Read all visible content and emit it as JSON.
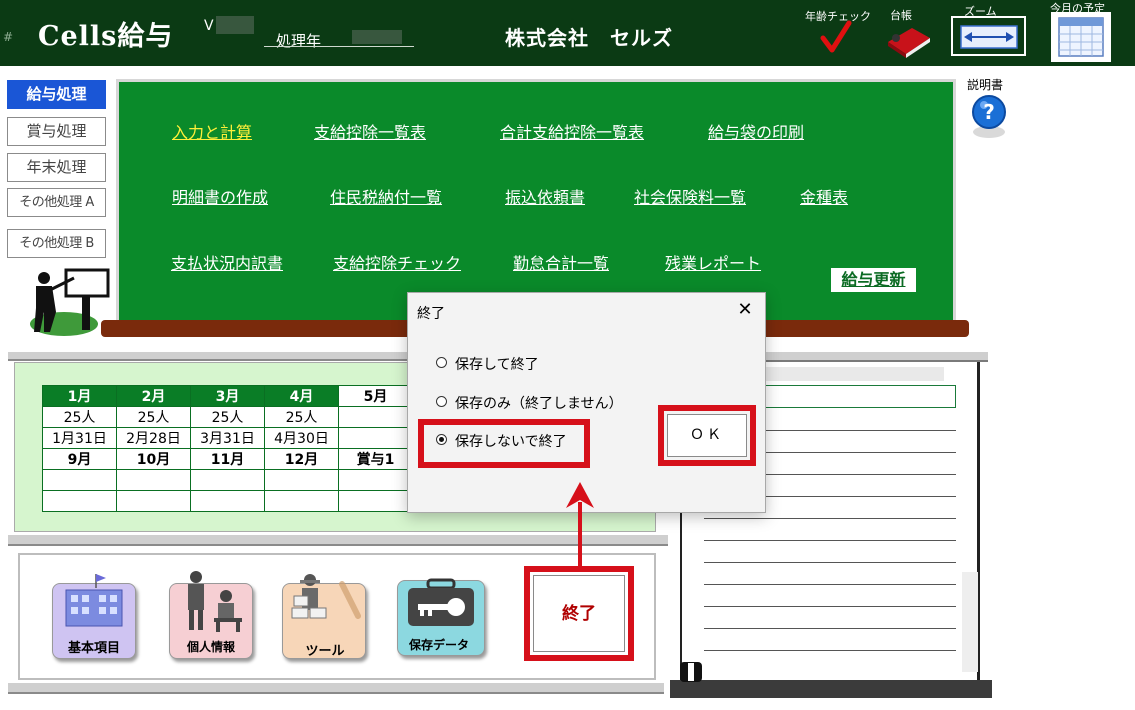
{
  "header": {
    "hash": "#",
    "app_title": "Cells給与",
    "version_prefix": "V",
    "year_label": "処理年",
    "company": "株式会社　セルズ",
    "age_check_label": "年齢チェック",
    "ledger_label": "台帳",
    "zoom_label": "ズーム",
    "schedule_label": "今月の予定"
  },
  "nav": {
    "items": [
      "給与処理",
      "賞与処理",
      "年末処理",
      "その他処理 A",
      "その他処理 B"
    ],
    "active_index": 0
  },
  "board": {
    "menu_row1": [
      "入力と計算",
      "支給控除一覧表",
      "合計支給控除一覧表",
      "給与袋の印刷"
    ],
    "menu_row2": [
      "明細書の作成",
      "住民税納付一覧",
      "振込依頼書",
      "社会保険料一覧",
      "金種表"
    ],
    "menu_row3": [
      "支払状況内訳書",
      "支給控除チェック",
      "勤怠合計一覧",
      "残業レポート"
    ],
    "update_button": "給与更新",
    "manual_label": "説明書"
  },
  "calendar": {
    "row1_months": [
      "1月",
      "2月",
      "3月",
      "4月",
      "5月"
    ],
    "row2_counts": [
      "25人",
      "25人",
      "25人",
      "25人",
      ""
    ],
    "row3_dates": [
      "1月31日",
      "2月28日",
      "3月31日",
      "4月30日",
      ""
    ],
    "row4_months": [
      "9月",
      "10月",
      "11月",
      "12月",
      "賞与1"
    ],
    "row5": [
      "",
      "",
      "",
      "",
      ""
    ],
    "row6": [
      "",
      "",
      "",
      "",
      ""
    ]
  },
  "buttons": {
    "basic_items": "基本項目",
    "personal_info": "個人情報",
    "tools": "ツール",
    "saved_data": "保存データ",
    "exit": "終了"
  },
  "dialog": {
    "title": "終了",
    "close_glyph": "✕",
    "options": [
      "保存して終了",
      "保存のみ（終了しません）",
      "保存しないで終了"
    ],
    "selected_index": 2,
    "ok_label": "ＯＫ"
  },
  "colors": {
    "header_bg": "#0b3a14",
    "board_green": "#0a8a2a",
    "highlight_red": "#d6101a",
    "nav_active": "#1a56d6"
  }
}
